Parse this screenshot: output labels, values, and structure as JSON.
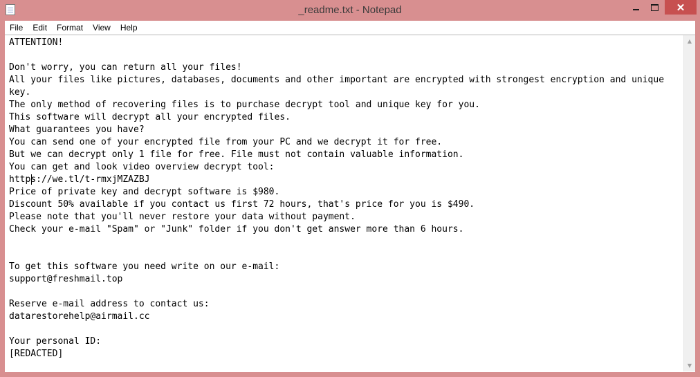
{
  "window": {
    "title": "_readme.txt - Notepad",
    "close_glyph": "✕"
  },
  "menu": [
    "File",
    "Edit",
    "Format",
    "View",
    "Help"
  ],
  "document": {
    "lines": [
      "ATTENTION!",
      "",
      "Don't worry, you can return all your files!",
      "All your files like pictures, databases, documents and other important are encrypted with strongest encryption and unique key.",
      "The only method of recovering files is to purchase decrypt tool and unique key for you.",
      "This software will decrypt all your encrypted files.",
      "What guarantees you have?",
      "You can send one of your encrypted file from your PC and we decrypt it for free.",
      "But we can decrypt only 1 file for free. File must not contain valuable information.",
      "You can get and look video overview decrypt tool:",
      "https://we.tl/t-rmxjMZAZBJ",
      "Price of private key and decrypt software is $980.",
      "Discount 50% available if you contact us first 72 hours, that's price for you is $490.",
      "Please note that you'll never restore your data without payment.",
      "Check your e-mail \"Spam\" or \"Junk\" folder if you don't get answer more than 6 hours.",
      "",
      "",
      "To get this software you need write on our e-mail:",
      "support@freshmail.top",
      "",
      "Reserve e-mail address to contact us:",
      "datarestorehelp@airmail.cc",
      "",
      "Your personal ID:",
      "[REDACTED]"
    ]
  },
  "scrollbar": {
    "up_glyph": "▲",
    "down_glyph": "▼"
  }
}
